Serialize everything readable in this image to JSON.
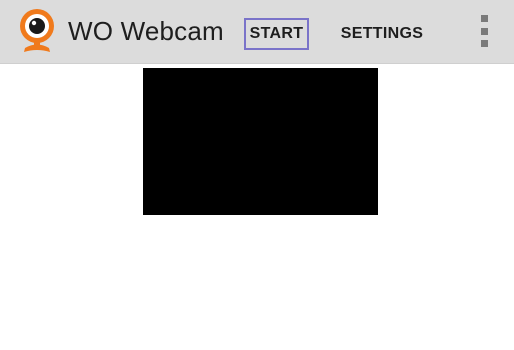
{
  "action_bar": {
    "app_icon": "webcam-icon",
    "title": "WO Webcam",
    "start_label": "START",
    "settings_label": "SETTINGS",
    "overflow_icon": "overflow-menu-icon"
  },
  "camera_preview": {
    "color": "#000000"
  },
  "colors": {
    "action_bar_bg": "#dcdcdc",
    "accent_orange": "#f07a1c",
    "focus_border": "#7a73c9"
  }
}
